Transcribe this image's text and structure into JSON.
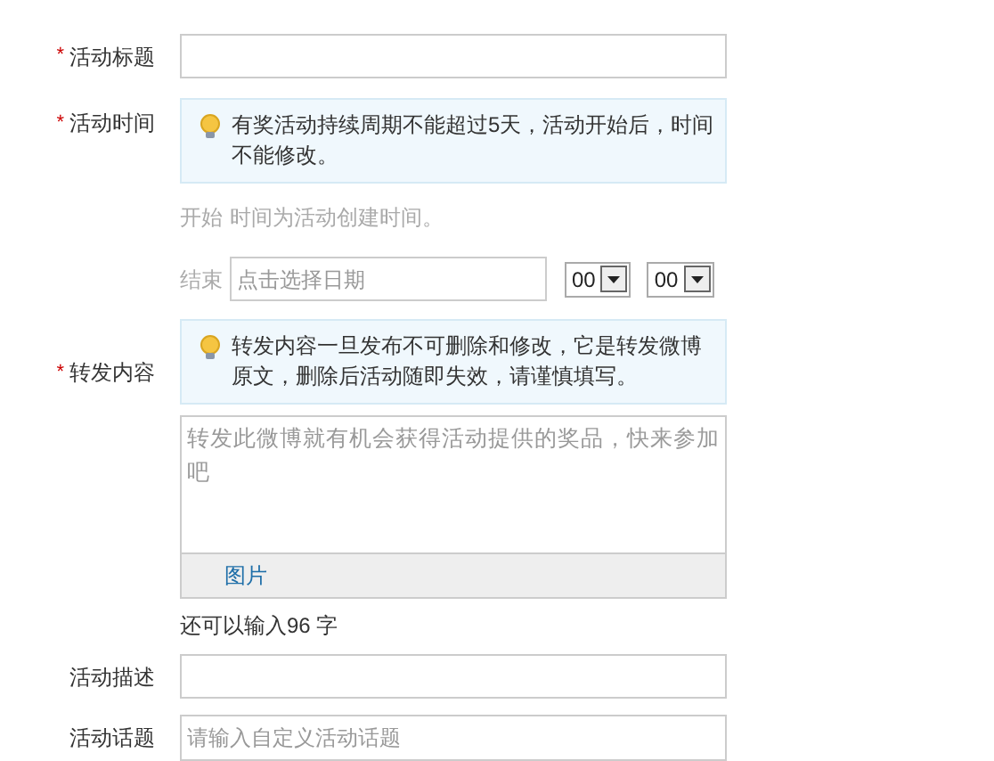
{
  "title_row": {
    "label": "活动标题",
    "required_mark": "*"
  },
  "time_row": {
    "label": "活动时间",
    "required_mark": "*",
    "tip": "有奖活动持续周期不能超过5天，活动开始后，时间不能修改。",
    "start_label": "开始",
    "start_note": "时间为活动创建时间。",
    "end_label": "结束",
    "end_date": {
      "placeholder": "点击选择日期"
    },
    "selects": [
      {
        "value": "00"
      },
      {
        "value": "00"
      }
    ]
  },
  "repost_row": {
    "label": "转发内容",
    "required_mark": "*",
    "tip": "转发内容一旦发布不可删除和修改，它是转发微博原文，删除后活动随即失效，请谨慎填写。",
    "editor": {
      "placeholder": "转发此微博就有机会获得活动提供的奖品，快来参加吧"
    },
    "toolbar_link": "图片",
    "counter": "还可以输入96 字"
  },
  "desc_row": {
    "label": "活动描述"
  },
  "topic_row": {
    "label": "活动话题",
    "placeholder": "请输入自定义活动话题"
  }
}
